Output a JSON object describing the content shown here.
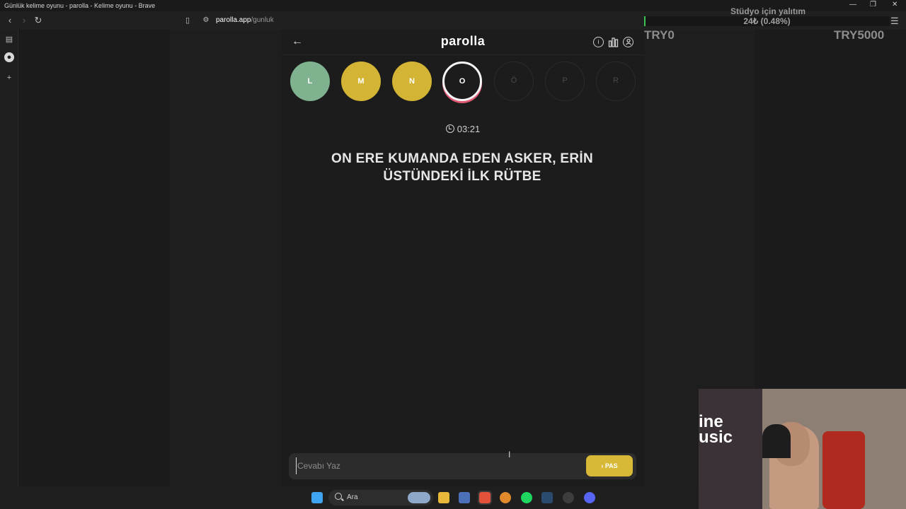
{
  "window": {
    "title": "Günlük kelime oyunu - parolla - Kelime oyunu - Brave",
    "controls": [
      "—",
      "❐",
      "✕"
    ]
  },
  "toolbar": {
    "url_host": "parolla.app",
    "url_path": "/gunluk"
  },
  "app": {
    "logo": "parolla",
    "letters": [
      {
        "letter": "L",
        "state": "correct"
      },
      {
        "letter": "M",
        "state": "passed"
      },
      {
        "letter": "N",
        "state": "passed"
      },
      {
        "letter": "O",
        "state": "current"
      },
      {
        "letter": "Ö",
        "state": "pending"
      },
      {
        "letter": "P",
        "state": "pending"
      },
      {
        "letter": "R",
        "state": "pending"
      }
    ],
    "timer": "03:21",
    "question": "ON ERE KUMANDA EDEN ASKER, ERİN ÜSTÜNDEKİ İLK RÜTBE",
    "answer_placeholder": "Cevabı Yaz",
    "pass_label": "PAS",
    "colors": {
      "correct": "#7fb28e",
      "passed": "#d4b435",
      "current_ring": "#e05a74"
    }
  },
  "overlay": {
    "goal_title": "Stüdyo için yalıtım",
    "progress_text": "24₺ (0.48%)",
    "progress_fraction": 0.0048,
    "min_label": "TRY0",
    "max_label": "TRY5000"
  },
  "taskbar": {
    "search_label": "Ara"
  },
  "webcam": {
    "neon_text": "ine\nusic"
  }
}
